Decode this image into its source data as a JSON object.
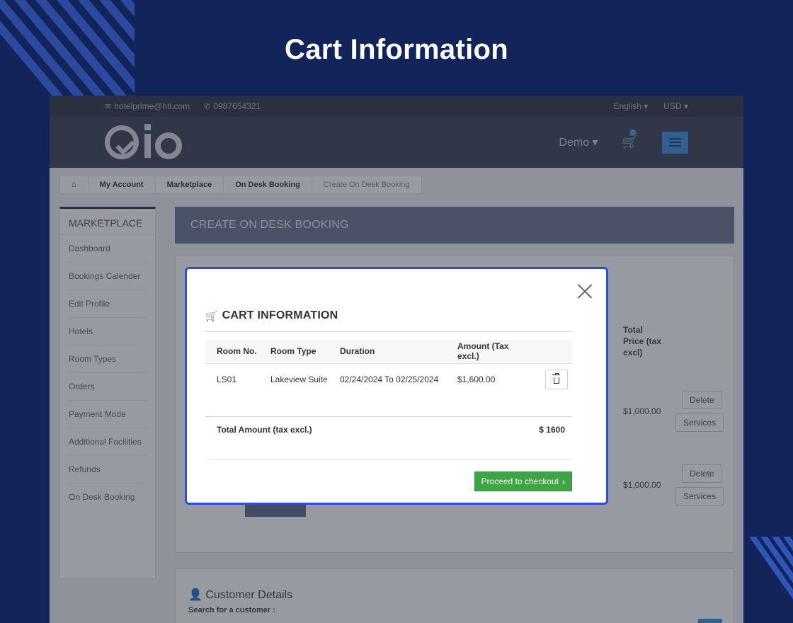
{
  "hero": {
    "title": "Cart Information"
  },
  "topbar": {
    "email": "hotelprime@htl.com",
    "phone": "0987654321",
    "language": "English ▾",
    "currency": "USD ▾"
  },
  "navbar": {
    "user": "Demo ▾",
    "cart_count": "0"
  },
  "breadcrumb": [
    "My Account",
    "Marketplace",
    "On Desk Booking",
    "Create On Desk Booking"
  ],
  "sidebar": {
    "title": "MARKETPLACE",
    "items": [
      {
        "label": "Dashboard",
        "icon": "dashboard-icon"
      },
      {
        "label": "Bookings Calender",
        "icon": "chart-icon"
      },
      {
        "label": "Edit Profile",
        "icon": "user-icon"
      },
      {
        "label": "Hotels",
        "icon": "building-icon"
      },
      {
        "label": "Room Types",
        "icon": "bed-icon"
      },
      {
        "label": "Orders",
        "icon": "card-icon"
      },
      {
        "label": "Payment Mode",
        "icon": "money-icon"
      },
      {
        "label": "Additional Facilities",
        "icon": "user-plus-icon"
      },
      {
        "label": "Refunds",
        "icon": "undo-icon"
      },
      {
        "label": "On Desk Booking",
        "icon": "calendar-icon"
      }
    ]
  },
  "main": {
    "header": "CREATE ON DESK BOOKING",
    "total_price_header": "Total Price (tax excl)",
    "row_prices": [
      "$1,000.00",
      "$1,000.00"
    ],
    "delete_label": "Delete",
    "services_label": "Services",
    "customer_title": "Customer Details",
    "customer_search": "Search for a customer :"
  },
  "modal": {
    "title": "CART INFORMATION",
    "columns": [
      "Room No.",
      "Room Type",
      "Duration",
      "Amount (Tax excl.)"
    ],
    "rows": [
      {
        "room_no": "LS01",
        "room_type": "Lakeview Suite",
        "duration": "02/24/2024 To 02/25/2024",
        "amount": "$1,600.00"
      }
    ],
    "total_label": "Total Amount (tax excl.)",
    "total_value": "$ 1600",
    "checkout_label": "Proceed to checkout"
  },
  "colors": {
    "background": "#13245a",
    "modal_border": "#2d4fd8",
    "checkout": "#3fa544",
    "accent_blue": "#3d8ee0"
  }
}
